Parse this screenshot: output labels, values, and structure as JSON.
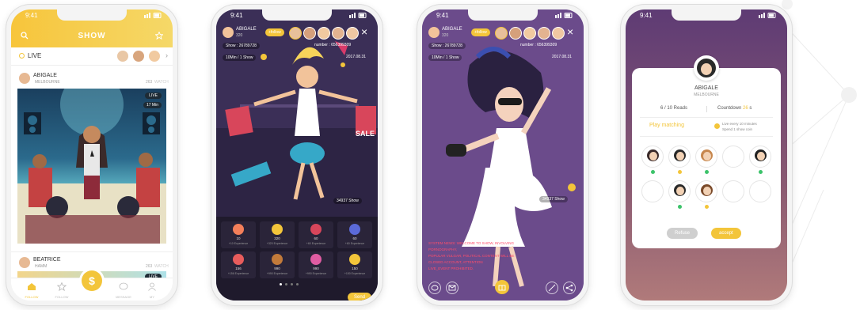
{
  "status": {
    "time": "9:41"
  },
  "screen1": {
    "title": "SHOW",
    "live_label": "LIVE",
    "card1": {
      "name": "ABIGALE",
      "location": "MELBOURNE",
      "count": "263",
      "count_unit": "WATCH",
      "badge_live": "LIVE",
      "viewers": "17 Min"
    },
    "card2": {
      "name": "BEATRICE",
      "location": "HAMM",
      "count": "263",
      "count_unit": "WATCH",
      "badge_live": "LIVE"
    },
    "nav": [
      {
        "label": "FOLLOW",
        "icon": "home-icon"
      },
      {
        "label": "FOLLOW",
        "icon": "star-icon"
      },
      {
        "label": "",
        "icon": "coin-icon"
      },
      {
        "label": "MESSAGE",
        "icon": "chat-icon"
      },
      {
        "label": "MY",
        "icon": "person-icon"
      }
    ],
    "coin_symbol": "$"
  },
  "screen2": {
    "host_name": "ABIGALE",
    "host_id": "320",
    "follow_label": "+follow",
    "show_label": "Show : 26789728",
    "number_label": "number : 656399309",
    "duration_label": "10Min / 1 Show",
    "date_label": "2017.08.31",
    "sale_text": "SALE",
    "viewer_count": "34937 Show",
    "gifts": [
      {
        "count": "10",
        "note": "+10 Experience"
      },
      {
        "count": "320",
        "note": "+320 Experience"
      },
      {
        "count": "60",
        "note": "+60 Experience"
      },
      {
        "count": "60",
        "note": "+60 Experience"
      },
      {
        "count": "156",
        "note": "+156 Experience"
      },
      {
        "count": "990",
        "note": "+990 Experience"
      },
      {
        "count": "990",
        "note": "+990 Experience"
      },
      {
        "count": "150",
        "note": "+150 Experience"
      }
    ],
    "send_label": "Send"
  },
  "screen3": {
    "host_name": "ABIGALE",
    "host_id": "320",
    "show_label": "Show : 26789728",
    "number_label": "number : 656399309",
    "duration_label": "10Min / 1 Show",
    "date_label": "2017.08.31",
    "viewer_count": "34937 Show",
    "chat_lines": [
      "SYSTEM NEWS: WELCOME TO SHOW, INVOLVING",
      "PORNOGRAPHY,",
      "POPULAR VULGAR, POLITICAL CONTENT WILL BE",
      "CLOSED ACCOUNT, ATTENTION",
      "LIVE_EVENT PROHIBITED."
    ]
  },
  "screen4": {
    "name": "ABIGALE",
    "location": "MELBOURNE",
    "reads": "6 / 10 Reads",
    "countdown_label": "Countdown",
    "countdown_value": "26",
    "countdown_unit": "s",
    "play_matching": "Play matching",
    "tip_line1": "Live every 10 minutes",
    "tip_line2": "Spend 1 show coin",
    "refuse_label": "Refuse",
    "accept_label": "accept"
  },
  "colors": {
    "accent": "#f3c53a",
    "dark_purple": "#3c2f52",
    "purple": "#6a4a8a",
    "teal": "#2fb6c7"
  }
}
